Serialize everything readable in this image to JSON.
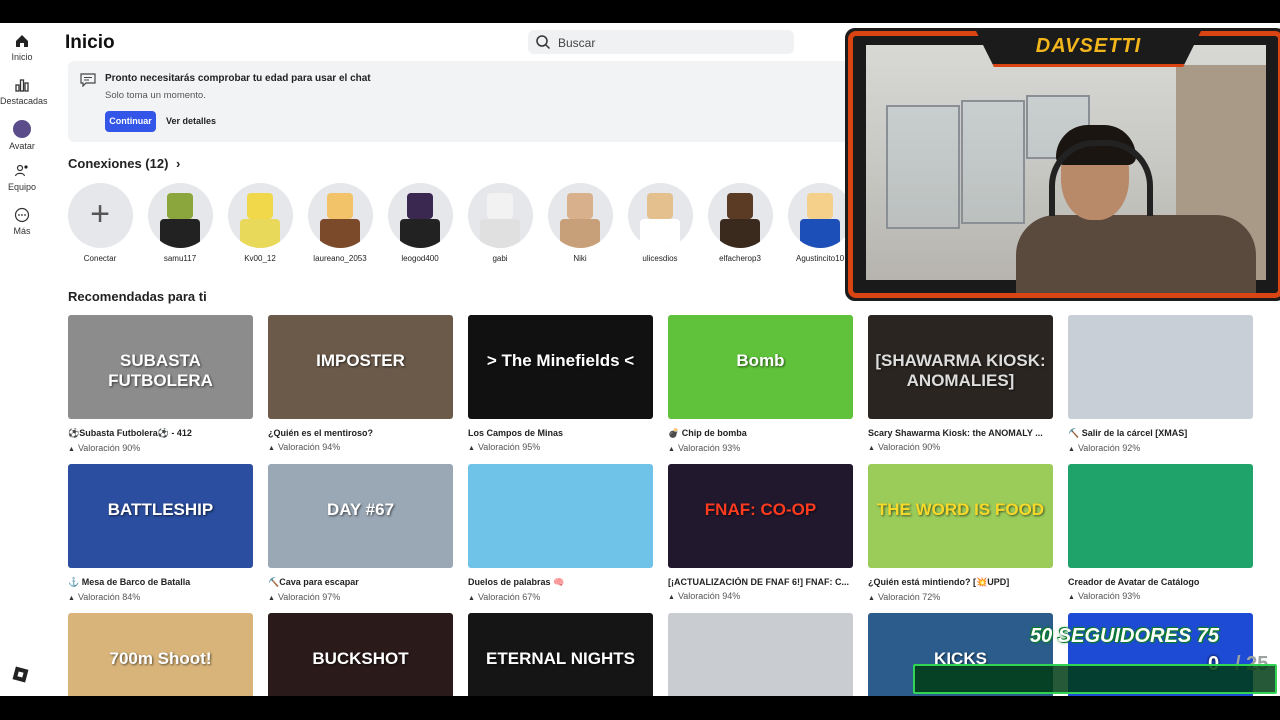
{
  "sidebar": {
    "items": [
      {
        "label": "Inicio",
        "icon": "home-icon"
      },
      {
        "label": "Destacadas",
        "icon": "chart-icon"
      },
      {
        "label": "Avatar",
        "icon": "avatar-icon"
      },
      {
        "label": "Equipo",
        "icon": "team-icon"
      },
      {
        "label": "Más",
        "icon": "more-icon"
      }
    ]
  },
  "header": {
    "title": "Inicio",
    "search_placeholder": "Buscar"
  },
  "notice": {
    "title": "Pronto necesitarás comprobar tu edad para usar el chat",
    "subtitle": "Solo toma un momento.",
    "primary_label": "Continuar",
    "secondary_label": "Ver detalles"
  },
  "connections": {
    "title": "Conexiones (12)",
    "add_label": "Conectar",
    "items": [
      {
        "name": "samu117",
        "head": "#8aa63d",
        "body": "#222222"
      },
      {
        "name": "Kv00_12",
        "head": "#f0d84a",
        "body": "#e8d95a"
      },
      {
        "name": "laureano_2053",
        "head": "#f3c36a",
        "body": "#7b4a2a"
      },
      {
        "name": "leogod400",
        "head": "#3b2850",
        "body": "#222222"
      },
      {
        "name": "gabi",
        "head": "#f2f2f2",
        "body": "#e0e0e0"
      },
      {
        "name": "Niki",
        "head": "#d9b08c",
        "body": "#c7a07a"
      },
      {
        "name": "ulicesdios",
        "head": "#e5c08f",
        "body": "#ffffff"
      },
      {
        "name": "elfacherop3",
        "head": "#5b3b24",
        "body": "#3a2a1e"
      },
      {
        "name": "Agustincito10",
        "head": "#f5d08a",
        "body": "#1d4fb8"
      }
    ]
  },
  "recommended": {
    "title": "Recomendadas para ti",
    "games": [
      {
        "title": "⚽Subasta Futbolera⚽ - 412",
        "rating": "Valoración 90%",
        "bg": "#8c8c8c",
        "text": "SUBASTA FUTBOLERA",
        "text_color": "#ffffff"
      },
      {
        "title": "¿Quién es el mentiroso?",
        "rating": "Valoración 94%",
        "bg": "#6b5a4a",
        "text": "IMPOSTER",
        "text_color": "#ffffff"
      },
      {
        "title": "Los Campos de Minas",
        "rating": "Valoración 95%",
        "bg": "#111111",
        "text": "> The Minefields <",
        "text_color": "#ffffff"
      },
      {
        "title": "💣 Chip de bomba",
        "rating": "Valoración 93%",
        "bg": "#5fc23a",
        "text": "Bomb",
        "text_color": "#ffffff"
      },
      {
        "title": "Scary Shawarma Kiosk: the ANOMALY ...",
        "rating": "Valoración 90%",
        "bg": "#2a2520",
        "text": "[SHAWARMA KIOSK: ANOMALIES]",
        "text_color": "#dddddd"
      },
      {
        "title": "⛏️ Salir de la cárcel [XMAS]",
        "rating": "Valoración 92%",
        "bg": "#c9cfd6",
        "text": "",
        "text_color": "#ffffff"
      },
      {
        "title": "⚓ Mesa de Barco de Batalla",
        "rating": "Valoración 84%",
        "bg": "#2b4ea0",
        "text": "BATTLESHIP",
        "text_color": "#ffffff"
      },
      {
        "title": "⛏️Cava para escapar",
        "rating": "Valoración 97%",
        "bg": "#9aa7b5",
        "text": "DAY #67",
        "text_color": "#ffffff"
      },
      {
        "title": "Duelos de palabras 🧠",
        "rating": "Valoración 67%",
        "bg": "#6fc3e8",
        "text": "",
        "text_color": "#ffffff"
      },
      {
        "title": "[¡ACTUALIZACIÓN DE FNAF 6!] FNAF: C...",
        "rating": "Valoración 94%",
        "bg": "#22182e",
        "text": "FNAF: CO-OP",
        "text_color": "#ff3b1f"
      },
      {
        "title": "¿Quién está mintiendo? [💥UPD]",
        "rating": "Valoración 72%",
        "bg": "#9bcc5a",
        "text": "THE WORD IS FOOD",
        "text_color": "#f7d92a"
      },
      {
        "title": "Creador de Avatar de Catálogo",
        "rating": "Valoración 93%",
        "bg": "#1fa36b",
        "text": "",
        "text_color": "#ffffff"
      },
      {
        "title": "",
        "rating": "",
        "bg": "#d8b47a",
        "text": "700m Shoot!",
        "text_color": "#ffffff"
      },
      {
        "title": "",
        "rating": "",
        "bg": "#2a1a1a",
        "text": "BUCKSHOT",
        "text_color": "#ffffff"
      },
      {
        "title": "",
        "rating": "",
        "bg": "#151515",
        "text": "ETERNAL NIGHTS",
        "text_color": "#ffffff"
      },
      {
        "title": "",
        "rating": "",
        "bg": "#c9ccd0",
        "text": "",
        "text_color": "#ffffff"
      },
      {
        "title": "",
        "rating": "",
        "bg": "#2b5c8c",
        "text": "KICKS",
        "text_color": "#ffffff"
      },
      {
        "title": "",
        "rating": "",
        "bg": "#1e4bd6",
        "text": "",
        "text_color": "#ffffff"
      }
    ]
  },
  "overlay": {
    "streamer_name": "DAVSETTI",
    "follower_goal_label": "50 SEGUIDORES 75",
    "follower_current": "0",
    "follower_total": "/ 25",
    "follower_progress": 0,
    "accent_color": "#d94412",
    "goal_color": "#32d454"
  }
}
